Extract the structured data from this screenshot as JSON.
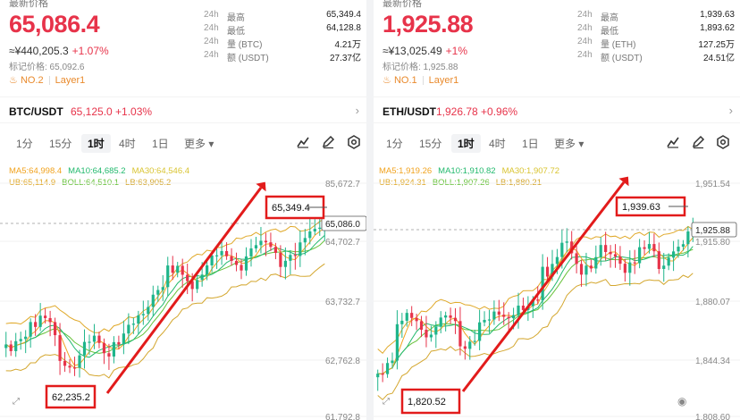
{
  "colors": {
    "up": "#e7334a",
    "down": "#1fb58b",
    "ma5": "#f1a31f",
    "ma10": "#22b96d",
    "ma30": "#d9c431",
    "ub": "#e0a92a",
    "boll": "#67c23a",
    "lb": "#d4a72f",
    "annotation": "#e21b1b"
  },
  "btc": {
    "top_label": "最新价格",
    "price": "65,086.4",
    "cny": "≈¥440,205.3",
    "change": "+1.07%",
    "mark_price": "标记价格: 65,092.6",
    "rank": "NO.2",
    "tag": "Layer1",
    "stats": [
      {
        "k1": "24h",
        "k2": "最高",
        "v": "65,349.4"
      },
      {
        "k1": "24h",
        "k2": "最低",
        "v": "64,128.8"
      },
      {
        "k1": "24h",
        "k2": "量 (BTC)",
        "v": "4.21万"
      },
      {
        "k1": "24h",
        "k2": "额 (USDT)",
        "v": "27.37亿"
      }
    ],
    "pair": "BTC/USDT",
    "pair_price": "65,125.0 +1.03%",
    "timeframes": [
      "1分",
      "15分",
      "1时",
      "4时",
      "1日",
      "更多 ▾"
    ],
    "active_tf": "1时",
    "ma_line1": [
      "MA5:64,998.4",
      "MA10:64,685.2",
      "MA30:64,546.4"
    ],
    "ma_line2": [
      "UB:65,114.9",
      "BOLL:64,510.1",
      "LB:63,905.2"
    ],
    "axis_labels": [
      "85,672.7",
      "64,702.7",
      "63,732.7",
      "62,762.8",
      "61,792.8"
    ],
    "current_label": "65,086.0",
    "high_box": "65,349.4",
    "low_box": "62,235.2"
  },
  "eth": {
    "top_label": "最新价格",
    "price": "1,925.88",
    "cny": "≈¥13,025.49",
    "change": "+1%",
    "mark_price": "标记价格: 1,925.88",
    "rank": "NO.1",
    "tag": "Layer1",
    "stats": [
      {
        "k1": "24h",
        "k2": "最高",
        "v": "1,939.63"
      },
      {
        "k1": "24h",
        "k2": "最低",
        "v": "1,893.62"
      },
      {
        "k1": "24h",
        "k2": "量 (ETH)",
        "v": "127.25万"
      },
      {
        "k1": "24h",
        "k2": "额 (USDT)",
        "v": "24.51亿"
      }
    ],
    "pair": "ETH/USDT",
    "pair_price": "1,926.78 +0.96%",
    "timeframes": [
      "1分",
      "15分",
      "1时",
      "4时",
      "1日",
      "更多 ▾"
    ],
    "active_tf": "1时",
    "ma_line1": [
      "MA5:1,919.26",
      "MA10:1,910.82",
      "MA30:1,907.72"
    ],
    "ma_line2": [
      "UB:1,924.31",
      "BOLL:1,907.26",
      "LB:1,880.21"
    ],
    "axis_labels": [
      "1,951.54",
      "1,915.80",
      "1,880.07",
      "1,844.34",
      "1,808.60"
    ],
    "current_label": "1,925.88",
    "high_box": "1,939.63",
    "low_box": "1,820.52"
  }
}
